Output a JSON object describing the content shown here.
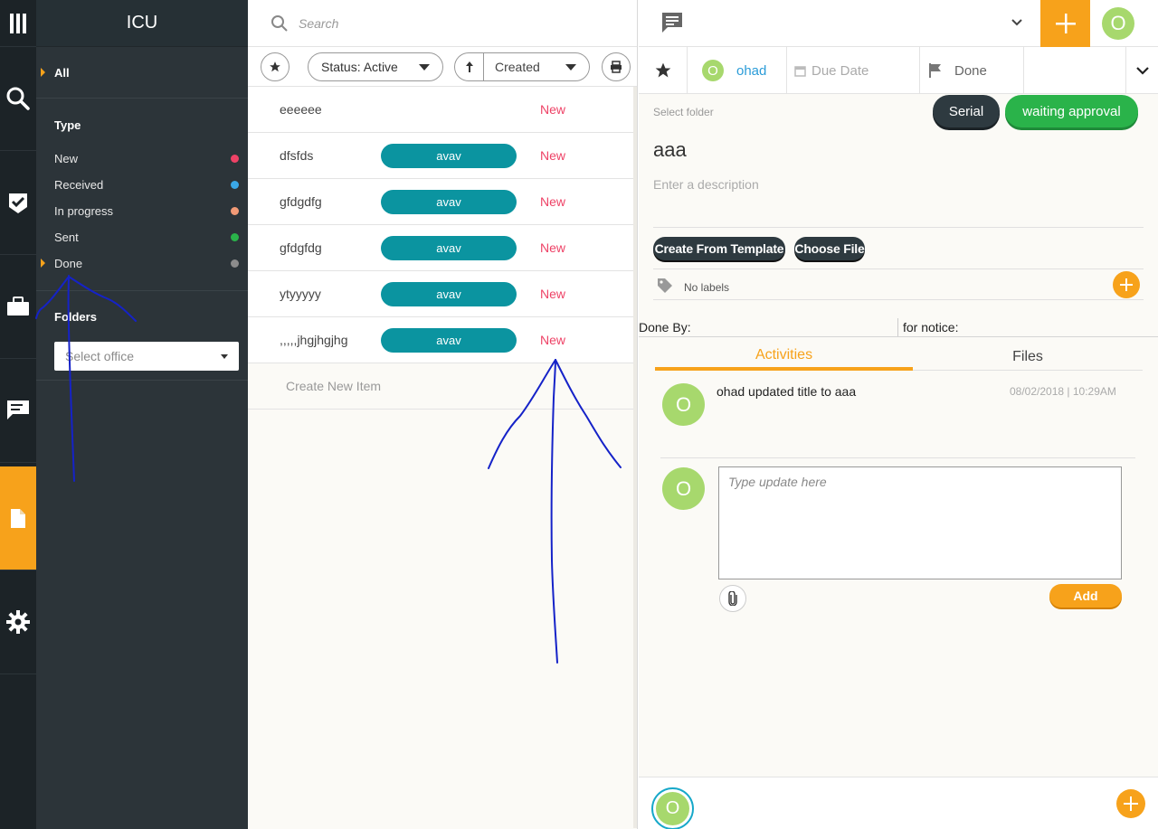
{
  "rail": {
    "items": [
      {
        "name": "search-icon"
      },
      {
        "name": "tasks-icon"
      },
      {
        "name": "projects-icon"
      },
      {
        "name": "discussions-icon"
      },
      {
        "name": "documents-icon"
      },
      {
        "name": "settings-icon"
      }
    ],
    "active_index": 4
  },
  "sidebar": {
    "title": "ICU",
    "all_label": "All",
    "type_heading": "Type",
    "types": [
      {
        "label": "New",
        "color": "#ee4266"
      },
      {
        "label": "Received",
        "color": "#3aa8e8"
      },
      {
        "label": "In progress",
        "color": "#f29a76"
      },
      {
        "label": "Sent",
        "color": "#2ab34a"
      },
      {
        "label": "Done",
        "color": "#8c8c8c"
      }
    ],
    "folders_heading": "Folders",
    "office_placeholder": "Select office"
  },
  "list": {
    "search_placeholder": "Search",
    "status_prefix": "Status:",
    "status_value": "Active",
    "sort_label": "Created",
    "rows": [
      {
        "title": "eeeeee",
        "chip": "",
        "status": "New"
      },
      {
        "title": "dfsfds",
        "chip": "avav",
        "status": "New"
      },
      {
        "title": "gfdgdfg",
        "chip": "avav",
        "status": "New"
      },
      {
        "title": "gfdgfdg",
        "chip": "avav",
        "status": "New"
      },
      {
        "title": "ytyyyyy",
        "chip": "avav",
        "status": "New"
      },
      {
        "title": ",,,,,jhgjhgjhg",
        "chip": "avav",
        "status": "New"
      }
    ],
    "create_new": "Create New Item"
  },
  "detail": {
    "user_initial": "O",
    "assignee": "ohad",
    "due_date": "Due Date",
    "status": "Done",
    "select_folder": "Select folder",
    "serial": "Serial",
    "approval": "waiting approval",
    "title": "aaa",
    "description_placeholder": "Enter a description",
    "create_from_template": "Create From Template",
    "choose_file": "Choose File",
    "no_labels": "No labels",
    "done_by": "Done By:",
    "for_notice": "for notice:",
    "tabs": [
      "Activities",
      "Files"
    ],
    "activity": {
      "text": "ohad updated title to aaa",
      "time": "08/02/2018 | 10:29AM"
    },
    "update_placeholder": "Type update here",
    "add_label": "Add"
  },
  "colors": {
    "accent": "#f7a21b",
    "chip": "#0b94a0",
    "status_new": "#ee4266",
    "avatar": "#a7d86d"
  }
}
